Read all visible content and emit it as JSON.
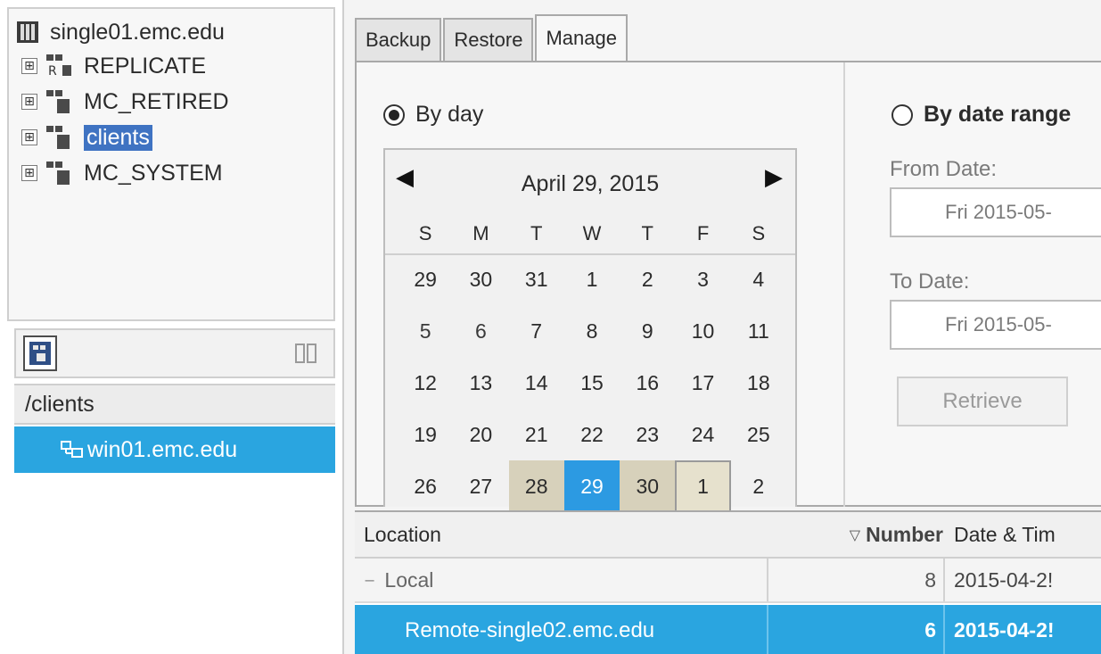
{
  "tree": {
    "root": {
      "label": "single01.emc.edu"
    },
    "domains": [
      {
        "label": "REPLICATE",
        "selected": false
      },
      {
        "label": "MC_RETIRED",
        "selected": false
      },
      {
        "label": "clients",
        "selected": true
      },
      {
        "label": "MC_SYSTEM",
        "selected": false
      }
    ],
    "expander_glyph": "⊞",
    "domain_icon_letter": "R"
  },
  "client_panel": {
    "path": "/clients",
    "clients": [
      {
        "label": "win01.emc.edu",
        "selected": true
      }
    ]
  },
  "tabs": [
    {
      "label": "Backup",
      "active": false
    },
    {
      "label": "Restore",
      "active": false
    },
    {
      "label": "Manage",
      "active": true
    }
  ],
  "manage": {
    "by_day": {
      "label": "By day",
      "checked": true
    },
    "by_date_range": {
      "label": "By date range",
      "checked": false
    },
    "calendar": {
      "title": "April 29, 2015",
      "prev_glyph": "◀",
      "next_glyph": "▶",
      "weekdays": [
        "S",
        "M",
        "T",
        "W",
        "T",
        "F",
        "S"
      ],
      "weeks": [
        [
          "29",
          "30",
          "31",
          "1",
          "2",
          "3",
          "4"
        ],
        [
          "5",
          "6",
          "7",
          "8",
          "9",
          "10",
          "11"
        ],
        [
          "12",
          "13",
          "14",
          "15",
          "16",
          "17",
          "18"
        ],
        [
          "19",
          "20",
          "21",
          "22",
          "23",
          "24",
          "25"
        ],
        [
          "26",
          "27",
          "28",
          "29",
          "30",
          "1",
          "2"
        ]
      ],
      "selected_day": "29"
    },
    "from_date": {
      "label": "From Date:",
      "value": "Fri 2015-05-"
    },
    "to_date": {
      "label": "To Date:",
      "value": "Fri 2015-05-"
    },
    "retrieve_label": "Retrieve"
  },
  "results": {
    "columns": [
      {
        "label": "Location"
      },
      {
        "label": "Number",
        "sort_glyph": "▽"
      },
      {
        "label": "Date & Tim"
      }
    ],
    "rows": [
      {
        "location": "Local",
        "number": "8",
        "date": "2015-04-2!",
        "group": true
      },
      {
        "location": "Remote-single02.emc.edu",
        "number": "6",
        "date": "2015-04-2!",
        "selected": true
      }
    ],
    "collapse_glyph": "−"
  },
  "colors": {
    "selection_blue": "#2aa5e0",
    "tree_selection": "#3f73c2",
    "calendar_selected": "#2c9ae2",
    "calendar_range": "#d7d1bb"
  }
}
